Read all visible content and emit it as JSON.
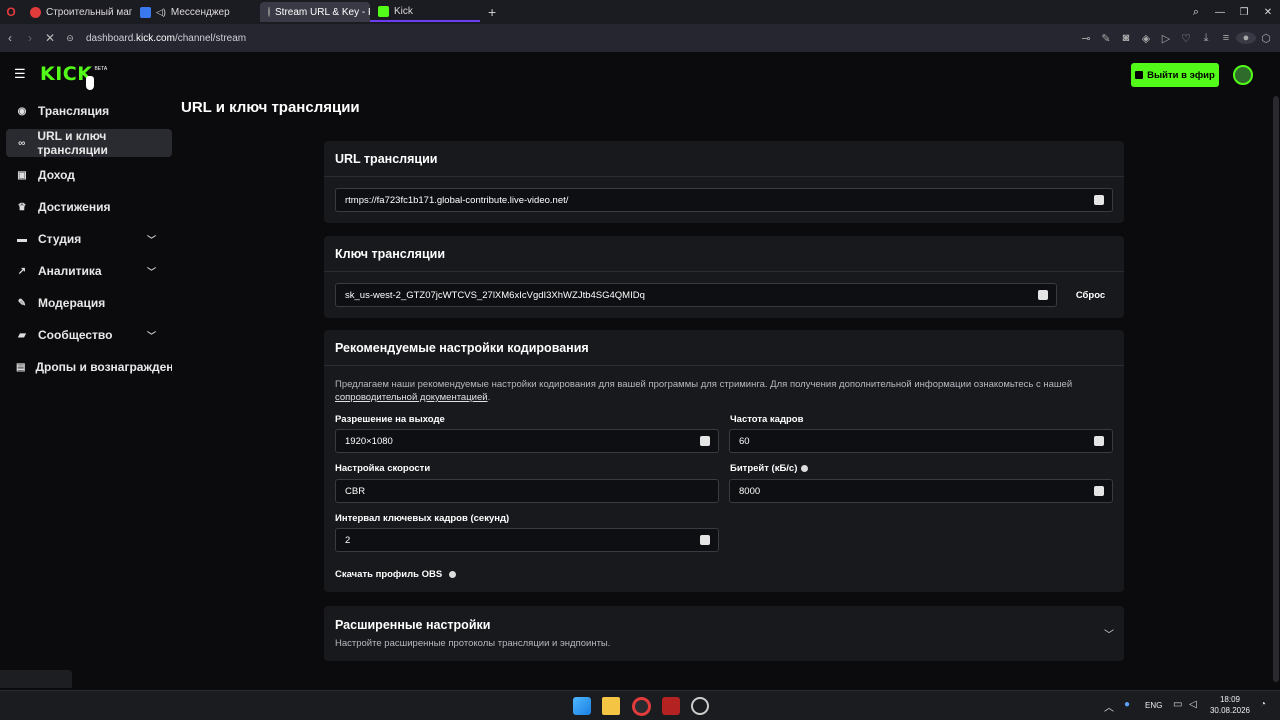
{
  "browser": {
    "tabs": [
      {
        "label": "Строительный магазин в",
        "color": "#e23b3b",
        "active": false
      },
      {
        "label": "Мессенджер",
        "color": "#3a78f0",
        "active": false
      },
      {
        "label": "Stream URL & Key - Kick",
        "color": "#777777",
        "active": true
      },
      {
        "label": "Kick",
        "color": "#53fc18",
        "active": false
      }
    ],
    "url_prefix": "dashboard.",
    "url_domain": "kick.com",
    "url_path": "/channel/stream"
  },
  "header": {
    "logo": "KICK",
    "logo_badge": "BETA",
    "go_live_label": "Выйти в эфир"
  },
  "sidebar": {
    "items": [
      {
        "label": "Трансляция",
        "icon": "broadcast-icon",
        "chevron": false,
        "selected": false
      },
      {
        "label": "URL и ключ трансляции",
        "icon": "link-icon",
        "chevron": false,
        "selected": true
      },
      {
        "label": "Доход",
        "icon": "wallet-icon",
        "chevron": false,
        "selected": false
      },
      {
        "label": "Достижения",
        "icon": "trophy-icon",
        "chevron": false,
        "selected": false
      },
      {
        "label": "Студия",
        "icon": "studio-icon",
        "chevron": true,
        "selected": false
      },
      {
        "label": "Аналитика",
        "icon": "analytics-icon",
        "chevron": true,
        "selected": false
      },
      {
        "label": "Модерация",
        "icon": "wrench-icon",
        "chevron": false,
        "selected": false
      },
      {
        "label": "Сообщество",
        "icon": "community-icon",
        "chevron": true,
        "selected": false
      },
      {
        "label": "Дропы и вознаграждени",
        "icon": "gift-icon",
        "chevron": false,
        "selected": false
      }
    ]
  },
  "page": {
    "title": "URL и ключ трансляции"
  },
  "stream_url": {
    "heading": "URL трансляции",
    "value": "rtmps://fa723fc1b171.global-contribute.live-video.net/"
  },
  "stream_key": {
    "heading": "Ключ трансляции",
    "value": "sk_us-west-2_GTZ07jcWTCVS_27lXM6xIcVgdI3XhWZJtb4SG4QMIDq",
    "reset_label": "Сброс"
  },
  "encoding": {
    "heading": "Рекомендуемые настройки кодирования",
    "description": "Предлагаем наши рекомендуемые настройки кодирования для вашей программы для стриминга. Для получения дополнительной информации ознакомьтесь с нашей",
    "doc_link": "сопроводительной документацией",
    "resolution_label": "Разрешение на выходе",
    "resolution_value": "1920×1080",
    "framerate_label": "Частота кадров",
    "framerate_value": "60",
    "rate_control_label": "Настройка скорости",
    "rate_control_value": "CBR",
    "bitrate_label": "Битрейт (кБ/с)",
    "bitrate_value": "8000",
    "keyframe_label": "Интервал ключевых кадров (секунд)",
    "keyframe_value": "2",
    "obs_profile_label": "Скачать профиль OBS"
  },
  "advanced": {
    "heading": "Расширенные настройки",
    "subtitle": "Настройте расширенные протоколы трансляции и эндпоинты."
  },
  "taskbar": {
    "lang": "ENG",
    "time": "18:09",
    "date": "30.08.2026"
  },
  "colors": {
    "brand": "#53fc18",
    "card": "#18191d",
    "background": "#0b0b0d"
  }
}
